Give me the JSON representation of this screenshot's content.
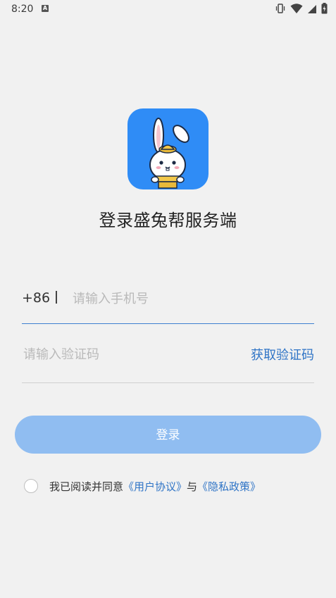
{
  "status_bar": {
    "time": "8:20",
    "notification_letter": "A",
    "icons": [
      "vibrate-icon",
      "wifi-icon",
      "signal-icon",
      "battery-charging-icon"
    ]
  },
  "app": {
    "title": "登录盛兔帮服务端"
  },
  "phone": {
    "country_code": "+86",
    "placeholder": "请输入手机号",
    "value": ""
  },
  "code": {
    "placeholder": "请输入验证码",
    "value": "",
    "get_code_label": "获取验证码"
  },
  "login": {
    "label": "登录"
  },
  "agreement": {
    "prefix": "我已阅读并同意",
    "user_agreement": "《用户协议》",
    "connector": "与",
    "privacy_policy": "《隐私政策》",
    "checked": false
  },
  "colors": {
    "accent": "#2f74c6",
    "logo_bg": "#2f8cf6",
    "button_bg": "#90bdf1",
    "page_bg": "#f1f1f1"
  }
}
